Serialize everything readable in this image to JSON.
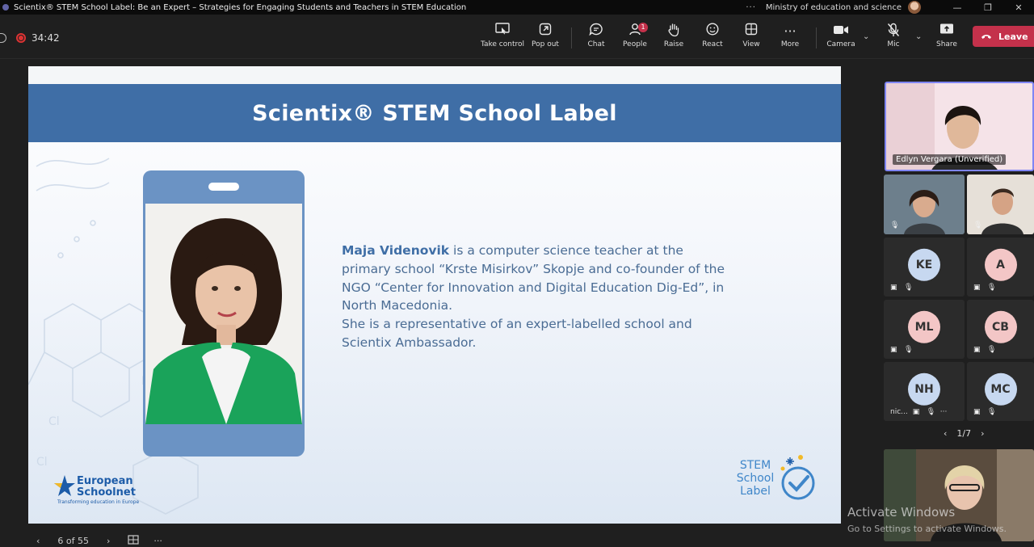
{
  "window": {
    "title": "Scientix® STEM School Label: Be an Expert – Strategies for Engaging Students and Teachers in STEM Education",
    "org": "Ministry of education and science",
    "more_dots": "···",
    "minimize": "—",
    "maximize": "❐",
    "close": "✕"
  },
  "meeting": {
    "elapsed": "34:42",
    "toolbar": {
      "take_control": "Take control",
      "pop_out": "Pop out",
      "chat": "Chat",
      "people": "People",
      "people_badge": "1",
      "raise": "Raise",
      "react": "React",
      "view": "View",
      "more": "More",
      "camera": "Camera",
      "mic": "Mic",
      "share": "Share",
      "leave": "Leave"
    }
  },
  "slide": {
    "title": "Scientix® STEM School Label",
    "bio_name": "Maja Videnovik",
    "bio_text": " is a computer science teacher at the primary school “Krste Misirkov” Skopje and co-founder of the NGO “Center for Innovation and Digital Education Dig-Ed”, in North Macedonia.",
    "bio_text2": "She is a representative of an expert-labelled school and Scientix Ambassador.",
    "eun_logo_line1": "European",
    "eun_logo_line2": "Schoolnet",
    "eun_logo_tagline": "Transforming education in Europe",
    "ssl_logo_line1": "STEM",
    "ssl_logo_line2": "School",
    "ssl_logo_line3": "Label",
    "counter": "6 of 55",
    "nav_prev": "‹",
    "nav_next": "›",
    "nav_more": "···"
  },
  "participants": {
    "featured_name": "Edlyn Vergara (Unverified)",
    "tiles": [
      {
        "initials": "KE",
        "color": "#c7d8f0"
      },
      {
        "initials": "A",
        "color": "#f3c6c6"
      },
      {
        "initials": "ML",
        "color": "#f3c6c6"
      },
      {
        "initials": "CB",
        "color": "#f3c6c6"
      },
      {
        "initials": "NH",
        "color": "#c7d8f0"
      },
      {
        "initials": "MC",
        "color": "#c7d8f0"
      }
    ],
    "nh_label": "nic...",
    "nh_more": "···",
    "pager": "1/7",
    "pager_prev": "‹",
    "pager_next": "›"
  },
  "watermark": {
    "line1": "Activate Windows",
    "line2": "Go to Settings to activate Windows."
  }
}
